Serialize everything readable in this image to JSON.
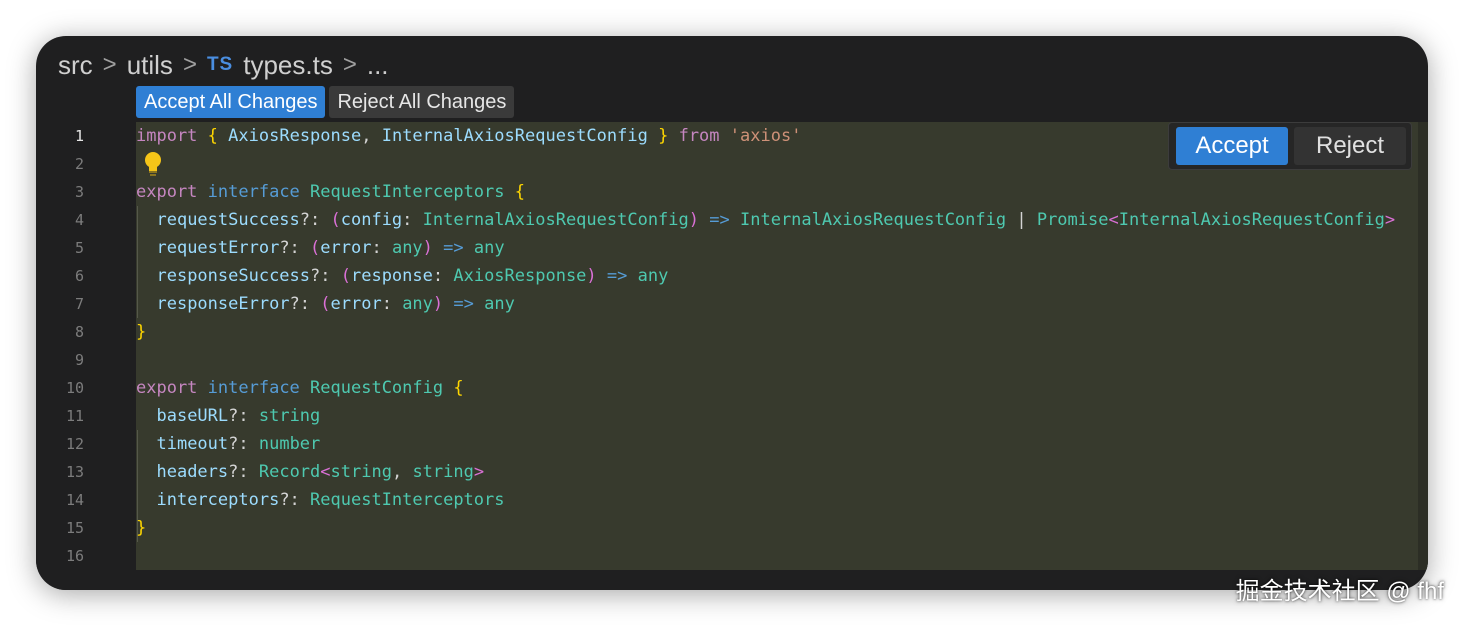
{
  "breadcrumb": {
    "items": [
      "src",
      "utils"
    ],
    "separator": ">",
    "file_badge": "TS",
    "file_name": "types.ts",
    "ellipsis": "..."
  },
  "diff_toolbar": {
    "accept_all_label": "Accept All Changes",
    "reject_all_label": "Reject All Changes"
  },
  "inline_actions": {
    "accept_label": "Accept",
    "reject_label": "Reject"
  },
  "editor": {
    "active_line": 1,
    "line_numbers": [
      "1",
      "2",
      "3",
      "4",
      "5",
      "6",
      "7",
      "8",
      "9",
      "10",
      "11",
      "12",
      "13",
      "14",
      "15",
      "16"
    ],
    "lines": [
      [
        [
          "kw",
          "import"
        ],
        [
          "pun",
          " "
        ],
        [
          "br1",
          "{"
        ],
        [
          "pun",
          " "
        ],
        [
          "prop",
          "AxiosResponse"
        ],
        [
          "pun",
          ", "
        ],
        [
          "prop",
          "InternalAxiosRequestConfig"
        ],
        [
          "pun",
          " "
        ],
        [
          "br1",
          "}"
        ],
        [
          "pun",
          " "
        ],
        [
          "kw",
          "from"
        ],
        [
          "pun",
          " "
        ],
        [
          "str",
          "'axios'"
        ]
      ],
      [],
      [
        [
          "kw",
          "export"
        ],
        [
          "pun",
          " "
        ],
        [
          "kw2",
          "interface"
        ],
        [
          "pun",
          " "
        ],
        [
          "ty",
          "RequestInterceptors"
        ],
        [
          "pun",
          " "
        ],
        [
          "br1",
          "{"
        ]
      ],
      [
        [
          "pun",
          "  "
        ],
        [
          "prop",
          "requestSuccess"
        ],
        [
          "pun",
          "?: "
        ],
        [
          "br2",
          "("
        ],
        [
          "prop",
          "config"
        ],
        [
          "pun",
          ": "
        ],
        [
          "ty",
          "InternalAxiosRequestConfig"
        ],
        [
          "br2",
          ")"
        ],
        [
          "pun",
          " "
        ],
        [
          "kw2",
          "=>"
        ],
        [
          "pun",
          " "
        ],
        [
          "ty",
          "InternalAxiosRequestConfig"
        ],
        [
          "pun",
          " | "
        ],
        [
          "ty",
          "Promise"
        ],
        [
          "br2",
          "<"
        ],
        [
          "ty",
          "InternalAxiosRequestConfig"
        ],
        [
          "br2",
          ">"
        ]
      ],
      [
        [
          "pun",
          "  "
        ],
        [
          "prop",
          "requestError"
        ],
        [
          "pun",
          "?: "
        ],
        [
          "br2",
          "("
        ],
        [
          "prop",
          "error"
        ],
        [
          "pun",
          ": "
        ],
        [
          "ty",
          "any"
        ],
        [
          "br2",
          ")"
        ],
        [
          "pun",
          " "
        ],
        [
          "kw2",
          "=>"
        ],
        [
          "pun",
          " "
        ],
        [
          "ty",
          "any"
        ]
      ],
      [
        [
          "pun",
          "  "
        ],
        [
          "prop",
          "responseSuccess"
        ],
        [
          "pun",
          "?: "
        ],
        [
          "br2",
          "("
        ],
        [
          "prop",
          "response"
        ],
        [
          "pun",
          ": "
        ],
        [
          "ty",
          "AxiosResponse"
        ],
        [
          "br2",
          ")"
        ],
        [
          "pun",
          " "
        ],
        [
          "kw2",
          "=>"
        ],
        [
          "pun",
          " "
        ],
        [
          "ty",
          "any"
        ]
      ],
      [
        [
          "pun",
          "  "
        ],
        [
          "prop",
          "responseError"
        ],
        [
          "pun",
          "?: "
        ],
        [
          "br2",
          "("
        ],
        [
          "prop",
          "error"
        ],
        [
          "pun",
          ": "
        ],
        [
          "ty",
          "any"
        ],
        [
          "br2",
          ")"
        ],
        [
          "pun",
          " "
        ],
        [
          "kw2",
          "=>"
        ],
        [
          "pun",
          " "
        ],
        [
          "ty",
          "any"
        ]
      ],
      [
        [
          "br1",
          "}"
        ]
      ],
      [],
      [
        [
          "kw",
          "export"
        ],
        [
          "pun",
          " "
        ],
        [
          "kw2",
          "interface"
        ],
        [
          "pun",
          " "
        ],
        [
          "ty",
          "RequestConfig"
        ],
        [
          "pun",
          " "
        ],
        [
          "br1",
          "{"
        ]
      ],
      [
        [
          "pun",
          "  "
        ],
        [
          "prop",
          "baseURL"
        ],
        [
          "pun",
          "?: "
        ],
        [
          "ty",
          "string"
        ]
      ],
      [
        [
          "pun",
          "  "
        ],
        [
          "prop",
          "timeout"
        ],
        [
          "pun",
          "?: "
        ],
        [
          "ty",
          "number"
        ]
      ],
      [
        [
          "pun",
          "  "
        ],
        [
          "prop",
          "headers"
        ],
        [
          "pun",
          "?: "
        ],
        [
          "ty",
          "Record"
        ],
        [
          "br2",
          "<"
        ],
        [
          "ty",
          "string"
        ],
        [
          "pun",
          ", "
        ],
        [
          "ty",
          "string"
        ],
        [
          "br2",
          ">"
        ]
      ],
      [
        [
          "pun",
          "  "
        ],
        [
          "prop",
          "interceptors"
        ],
        [
          "pun",
          "?: "
        ],
        [
          "ty",
          "RequestInterceptors"
        ]
      ],
      [
        [
          "br1",
          "}"
        ]
      ],
      []
    ]
  },
  "icons": {
    "lightbulb": "lightbulb-icon"
  },
  "watermark": "掘金技术社区 @ fhf",
  "colors": {
    "accent": "#2f7fd4",
    "diff_added_bg": "#373a2d",
    "editor_bg": "#1f1f20"
  }
}
